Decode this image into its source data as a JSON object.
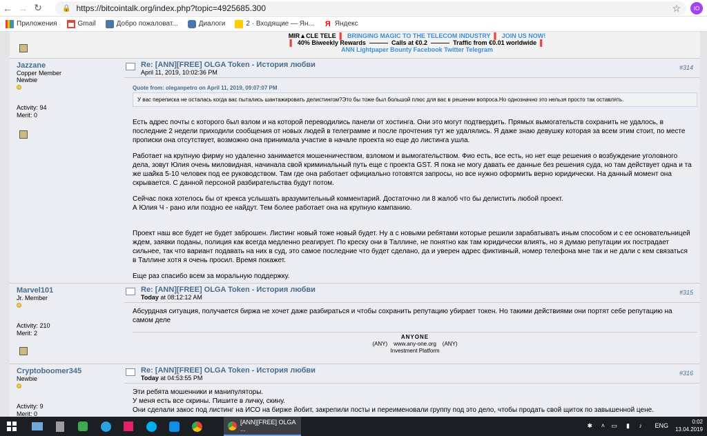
{
  "browser": {
    "url": "https://bitcointalk.org/index.php?topic=4925685.300",
    "avatar_initials": "IO"
  },
  "bookmarks": [
    {
      "label": "Приложения"
    },
    {
      "label": "Gmail"
    },
    {
      "label": "Добро пожаловат..."
    },
    {
      "label": "Диалоги"
    },
    {
      "label": "2 · Входящие — Ян..."
    },
    {
      "label": "Яндекс"
    }
  ],
  "signature_top": {
    "line1_a": "MIR▲CLE TELE",
    "line1_b": "BRINGING MAGIC TO THE TELECOM INDUSTRY",
    "line1_c": "JOIN US NOW!",
    "line2_a": "40% Biweekly Rewards",
    "line2_b": "Calls at €0.2",
    "line2_c": "Traffic from €0.01 worldwide",
    "line3": "ANN  Lightpaper  Bounty  Facebook  Twitter  Telegram"
  },
  "posts": [
    {
      "username": "Jazzane",
      "rank1": "Copper Member",
      "rank2": "Newbie",
      "activity": "Activity: 94",
      "merit": "Merit: 0",
      "title": "Re: [ANN][FREE] OLGA Token - История любви",
      "date": "April 11, 2019, 10:02:36 PM",
      "num": "#314",
      "quote_head": "Quote from: oleganpetro on April 11, 2019, 09:07:07 PM",
      "quote": "У вас переписка не осталась когда вас пытались шантажировать делистингом?Это бы тоже был большой плюс для вас в решении вопроса.Но однозначно это нельзя просто так оставлять.",
      "paragraphs": [
        "Есть адрес почты с которого был взлом и на которой переводились панели от хостинга. Они это могут подтвердить. Прямых вымогательств сохранить не удалось, в последние 2 недели приходили сообщения от новых людей в телеграмме и после прочтения тут же удалялись. Я даже знаю девушку которая за всем этим стоит, по месте прописки она отсутствует, возможно она принимала участие в начале проекта но еще до листинга ушла.",
        "Работает на крупную фирму но удаленно занимается мошенничеством, взломом и вымогательством. Фио есть, все есть, но нет еще решения о возбуждение уголовного дела, зовут Юлия очень миловидная, начинала свой криминальный путь еще с проекта GST. Я пока не могу давать ее данные без решения суда, но там действует одна и та же шайка 5-10 человек под ее руководством. Там где она работает официально готовятся запросы, но все нужно оформить верно юридически. На данный момент она скрывается. С данной персоной разбирательства будут потом.",
        "Сейчас пока хотелось бы от крекса услышать вразумительный комментарий. Достаточно ли 8 жалоб что бы делистить любой проект.\nА Юлия Ч  - рано или поздно ее найдут. Тем более работает она на крупную кампанию.",
        "Проект наш все будет не будет заброшен. Листинг новый тоже новый будет. Ну а с новыми ребятами которые решили зарабатывать иным способом и с ее основательницей ждем, заявки поданы, полиция как всегда медленно реагирует. По креску они в Таллине, не понятно как там юридически влиять, но я думаю репутации их пострадает сильнее, так что вариант подавать на них в суд, это самое последние что будет сделано, да и уверен адрес фиктивный, номер телефона мне так и не дали с кем связаться в Таллине хотя я очень просил. Время покажет.",
        "Еще раз спасибо всем за моральную поддержку."
      ]
    },
    {
      "username": "Marvel101",
      "rank1": "Jr. Member",
      "activity": "Activity: 210",
      "merit": "Merit: 2",
      "title": "Re: [ANN][FREE] OLGA Token - История любви",
      "date_bold": "Today",
      "date": " at 08:12:12 AM",
      "num": "#315",
      "paragraphs": [
        "Абсурдная ситуация, получается биржа не хочет даже разбираться и чтобы сохранить репутацию убирает токен. Но такими действиями они портят себе репутацию на самом деле"
      ],
      "sig1": "ANYONE",
      "sig2": "(ANY)    www.any-one.org    (ANY)",
      "sig3": "Investment Platform"
    },
    {
      "username": "Cryptoboomer345",
      "rank1": "Newbie",
      "activity": "Activity: 9",
      "merit": "Merit: 0",
      "title": "Re: [ANN][FREE] OLGA Token - История любви",
      "date_bold": "Today",
      "date": " at 04:53:55 PM",
      "num": "#316",
      "paragraphs": [
        "Эти ребята мошенники и манипуляторы.\nУ меня есть все скрины. Пишите в личку, скину.\nОни сделали закос под листинг на ИСО на бирже йобит, закрепили посты и переименовали группу под это дело, чтобы продать свой щиток по завышенной цене."
      ]
    }
  ],
  "taskbar": {
    "active_window": "[ANN][FREE] OLGA ...",
    "lang": "ENG",
    "time": "0:02",
    "date": "13.04.2019"
  }
}
